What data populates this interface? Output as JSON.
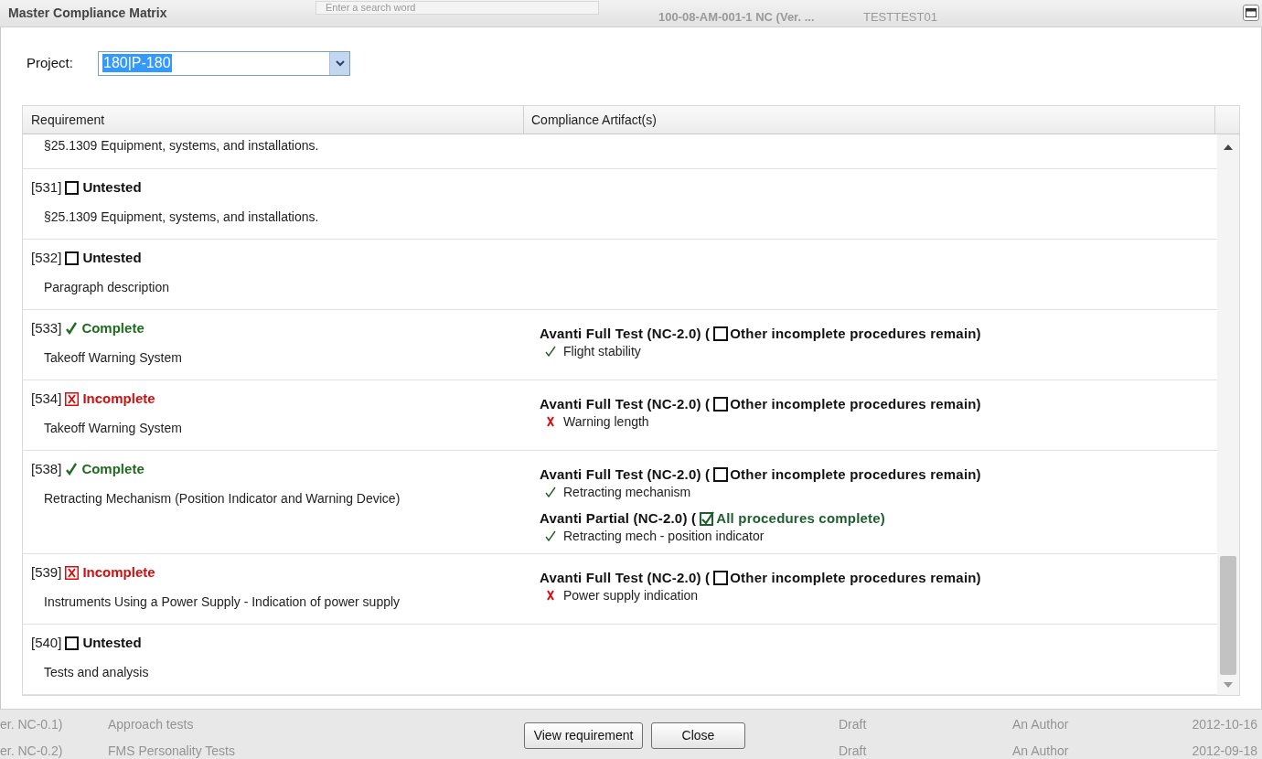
{
  "window": {
    "title": "Master Compliance Matrix"
  },
  "background_page": {
    "search_placeholder": "Enter a search word",
    "top_texts": [
      "100-08-AM-001-1 NC (Ver. ...",
      "TESTTEST01"
    ],
    "rows": [
      [
        "er. NC-0.1)",
        "Approach tests",
        "Draft",
        "An Author",
        "2012-10-16"
      ],
      [
        "er. NC-0.2)",
        "FMS Personality Tests",
        "Draft",
        "An Author",
        "2012-09-18"
      ]
    ]
  },
  "project": {
    "label": "Project:",
    "value": "180|P-180"
  },
  "table": {
    "columns": [
      "Requirement",
      "Compliance Artifact(s)"
    ],
    "rows": [
      {
        "description": "§25.1309 Equipment, systems, and installations.",
        "artifacts": []
      },
      {
        "id": "[531]",
        "kind": "untested",
        "status_label": "Untested",
        "description": "§25.1309 Equipment, systems, and installations.",
        "artifacts": []
      },
      {
        "id": "[532]",
        "kind": "untested",
        "status_label": "Untested",
        "description": "Paragraph description",
        "artifacts": []
      },
      {
        "id": "[533]",
        "kind": "complete",
        "status_label": "Complete",
        "description": "Takeoff Warning System",
        "artifacts": [
          {
            "name": "Avanti Full Test (NC-2.0) (",
            "checked": false,
            "note": "Other incomplete procedures remain)",
            "steps": [
              {
                "passed": true,
                "label": "Flight stability"
              }
            ]
          }
        ]
      },
      {
        "id": "[534]",
        "kind": "incomplete",
        "status_label": "Incomplete",
        "description": "Takeoff Warning System",
        "artifacts": [
          {
            "name": "Avanti Full Test (NC-2.0) (",
            "checked": false,
            "note": "Other incomplete procedures remain)",
            "steps": [
              {
                "passed": false,
                "label": "Warning length"
              }
            ]
          }
        ]
      },
      {
        "id": "[538]",
        "kind": "complete",
        "status_label": "Complete",
        "description": "Retracting Mechanism (Position Indicator and Warning Device)",
        "artifacts": [
          {
            "name": "Avanti Full Test (NC-2.0) (",
            "checked": false,
            "note": "Other incomplete procedures remain)",
            "steps": [
              {
                "passed": true,
                "label": "Retracting mechanism"
              }
            ]
          },
          {
            "name": "Avanti Partial (NC-2.0) (",
            "checked": true,
            "note": "All procedures complete)",
            "steps": [
              {
                "passed": true,
                "label": "Retracting mech - position indicator"
              }
            ]
          }
        ]
      },
      {
        "id": "[539]",
        "kind": "incomplete",
        "status_label": "Incomplete",
        "description": "Instruments Using a Power Supply - Indication of power supply",
        "artifacts": [
          {
            "name": "Avanti Full Test (NC-2.0) (",
            "checked": false,
            "note": "Other incomplete procedures remain)",
            "steps": [
              {
                "passed": false,
                "label": "Power supply indication"
              }
            ]
          }
        ]
      },
      {
        "id": "[540]",
        "kind": "untested",
        "status_label": "Untested",
        "description": "Tests and analysis",
        "artifacts": []
      }
    ]
  },
  "buttons": [
    "View requirement",
    "Close"
  ]
}
